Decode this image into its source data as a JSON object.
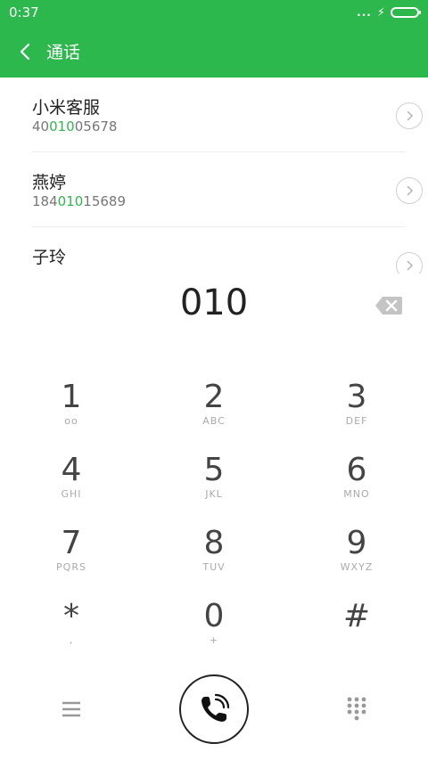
{
  "status_bar": {
    "time": "0:37",
    "dots": "..."
  },
  "app_bar": {
    "title": "通话"
  },
  "contacts": [
    {
      "name": "小米客服",
      "number_pre": "40",
      "number_match": "010",
      "number_post": "05678"
    },
    {
      "name": "燕婷",
      "number_pre": "184",
      "number_match": "010",
      "number_post": "15689"
    },
    {
      "name": "子玲",
      "number_pre": "",
      "number_match": "",
      "number_post": ""
    }
  ],
  "dialed": "010",
  "keys": [
    {
      "digit": "1",
      "sub": "oo"
    },
    {
      "digit": "2",
      "sub": "ABC"
    },
    {
      "digit": "3",
      "sub": "DEF"
    },
    {
      "digit": "4",
      "sub": "GHI"
    },
    {
      "digit": "5",
      "sub": "JKL"
    },
    {
      "digit": "6",
      "sub": "MNO"
    },
    {
      "digit": "7",
      "sub": "PQRS"
    },
    {
      "digit": "8",
      "sub": "TUV"
    },
    {
      "digit": "9",
      "sub": "WXYZ"
    },
    {
      "digit": "*",
      "sub": ","
    },
    {
      "digit": "0",
      "sub": "+"
    },
    {
      "digit": "#",
      "sub": ""
    }
  ],
  "icons": {
    "back": "chevron-left-icon",
    "detail": "chevron-right-circle-icon",
    "backspace": "backspace-icon",
    "menu": "menu-icon",
    "call": "phone-icon",
    "dialpad": "dialpad-icon"
  },
  "colors": {
    "accent": "#2db84d"
  }
}
